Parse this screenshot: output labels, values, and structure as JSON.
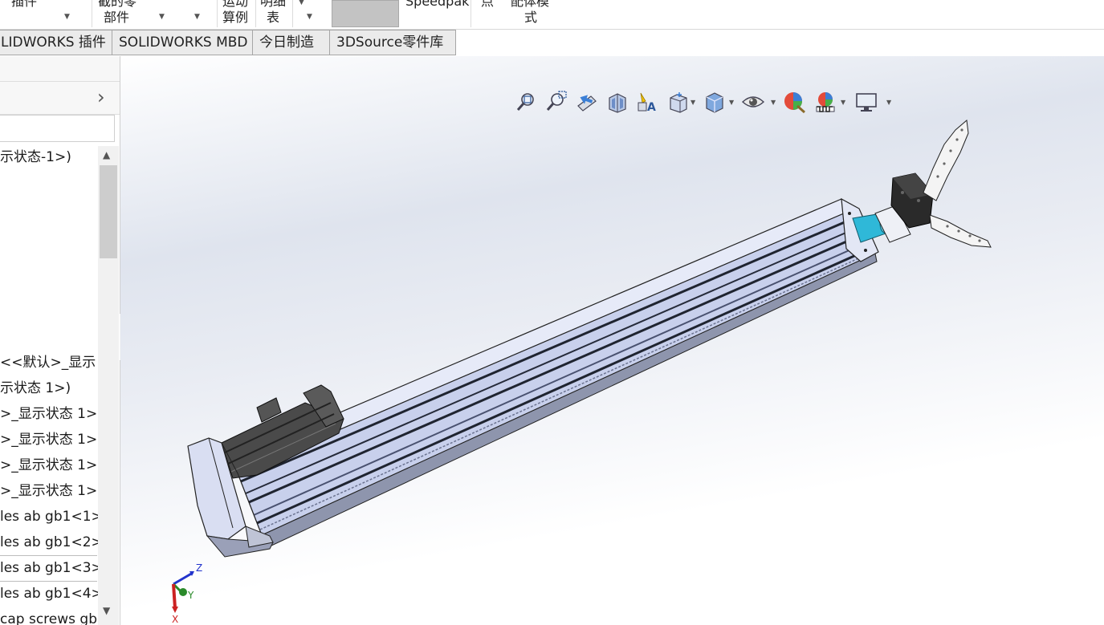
{
  "ribbon": {
    "items": [
      {
        "label": "插件"
      },
      {
        "label": "截的零"
      },
      {
        "label": "部件"
      },
      {
        "label": "运动"
      },
      {
        "label": "算例"
      },
      {
        "label": "明细"
      },
      {
        "label": "表"
      },
      {
        "label": "Speedpak"
      },
      {
        "label": "点"
      },
      {
        "label": "配体模"
      },
      {
        "label": "式"
      }
    ]
  },
  "tabs": [
    {
      "label": "LIDWORKS 插件"
    },
    {
      "label": "SOLIDWORKS MBD"
    },
    {
      "label": "今日制造"
    },
    {
      "label": "3DSource零件库"
    }
  ],
  "tree": {
    "items": [
      {
        "label": "示状态-1>)"
      },
      {
        "label": "<<默认>_显示"
      },
      {
        "label": "示状态 1>)"
      },
      {
        "label": ">_显示状态 1>"
      },
      {
        "label": ">_显示状态 1>"
      },
      {
        "label": ">_显示状态 1>"
      },
      {
        "label": ">_显示状态 1>"
      },
      {
        "label": "les ab gb1<1>"
      },
      {
        "label": "les ab gb1<2>"
      },
      {
        "label": "les ab gb1<3>"
      },
      {
        "label": "les ab gb1<4>"
      },
      {
        "label": "cap screws gb"
      }
    ]
  },
  "hud": {
    "icons": [
      "zoom-to-fit-icon",
      "zoom-area-icon",
      "previous-view-icon",
      "section-view-icon",
      "view-dynamic-annotation-icon",
      "view-orientation-icon",
      "display-style-icon",
      "hide-show-items-icon",
      "edit-appearance-icon",
      "apply-scene-icon",
      "view-settings-icon"
    ]
  },
  "triad": {
    "x_label": "X",
    "y_label": "Y",
    "z_label": "Z"
  },
  "colors": {
    "accent": "#2b579a",
    "rail": "#c8d0ec",
    "motor": "#3a3a3a",
    "coupling": "#2fb8d8"
  }
}
